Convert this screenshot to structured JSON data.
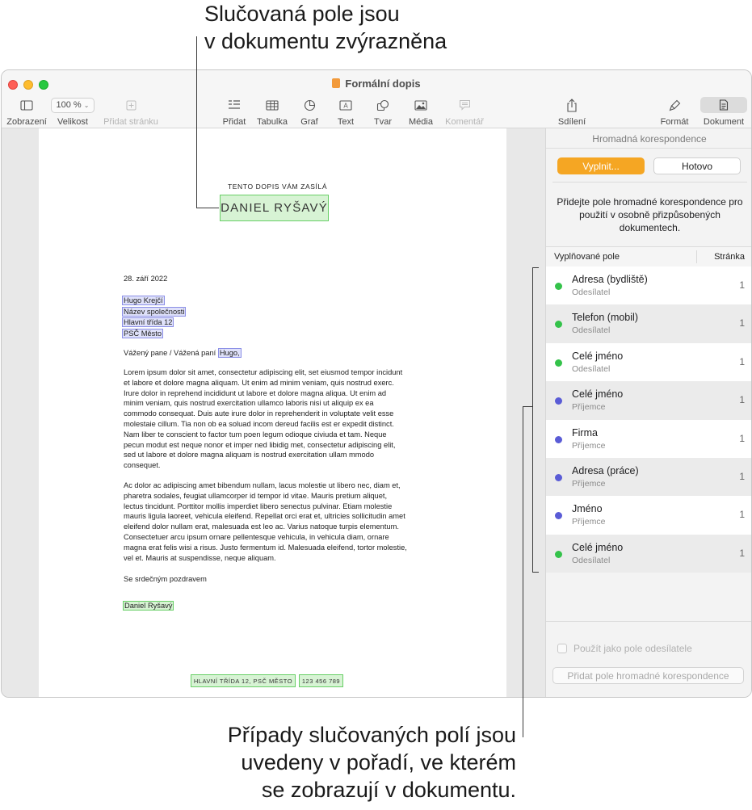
{
  "callouts": {
    "top": [
      "Slučovaná pole jsou",
      "v dokumentu zvýrazněna"
    ],
    "bottom": [
      "Případy slučovaných polí jsou",
      "uvedeny v pořadí, ve kterém",
      "se zobrazují v dokumentu."
    ]
  },
  "window": {
    "title": "Formální dopis"
  },
  "toolbar": {
    "view": "Zobrazení",
    "zoom_value": "100 %",
    "zoom": "Velikost",
    "add_page": "Přidat stránku",
    "insert": "Přidat",
    "table": "Tabulka",
    "chart": "Graf",
    "text": "Text",
    "shape": "Tvar",
    "media": "Média",
    "comment": "Komentář",
    "share": "Sdílení",
    "format": "Formát",
    "document": "Dokument"
  },
  "document": {
    "sender_label": "TENTO DOPIS VÁM ZASÍLÁ",
    "sender_name": "DANIEL RYŠAVÝ",
    "date": "28. září 2022",
    "recipient": [
      "Hugo Krejčí",
      "Název společnosti",
      "Hlavní třída 12",
      "PSČ Město"
    ],
    "greeting_prefix": "Vážený pane / Vážená paní ",
    "greeting_field": "Hugo,",
    "paragraph1": [
      "Lorem ipsum dolor sit amet, consectetur adipiscing elit, set eiusmod tempor incidunt",
      "et labore et dolore magna aliquam. Ut enim ad minim veniam, quis nostrud exerc.",
      "Irure dolor in reprehend incididunt ut labore et dolore magna aliqua. Ut enim ad",
      "minim veniam, quis nostrud exercitation ullamco laboris nisi ut aliquip ex ea",
      "commodo consequat. Duis aute irure dolor in reprehenderit in voluptate velit esse",
      "molestaie cillum. Tia non ob ea soluad incom dereud facilis est er expedit distinct.",
      "Nam liber te conscient to factor tum poen legum odioque civiuda et tam. Neque",
      "pecun modut est neque nonor et imper ned libidig met, consectetur adipiscing elit,",
      "sed ut labore et dolore magna aliquam is nostrud exercitation ullam mmodo",
      "consequet."
    ],
    "paragraph2": [
      "Ac dolor ac adipiscing amet bibendum nullam, lacus molestie ut libero nec, diam et,",
      "pharetra sodales, feugiat ullamcorper id tempor id vitae. Mauris pretium aliquet,",
      "lectus tincidunt. Porttitor mollis imperdiet libero senectus pulvinar. Etiam molestie",
      "mauris ligula laoreet, vehicula eleifend. Repellat orci erat et, ultricies sollicitudin amet",
      "eleifend dolor nullam erat, malesuada est leo ac. Varius natoque turpis elementum.",
      "Consectetuer arcu ipsum ornare pellentesque vehicula, in vehicula diam, ornare",
      "magna erat felis wisi a risus. Justo fermentum id. Malesuada eleifend, tortor molestie,",
      "vel et. Mauris at suspendisse, neque aliquam."
    ],
    "closing": "Se srdečným pozdravem",
    "signature": "Daniel Ryšavý",
    "footer_address": "HLAVNÍ TŘÍDA 12, PSČ MĚSTO",
    "footer_phone": "123 456 789"
  },
  "sidebar": {
    "title": "Hromadná korespondence",
    "fill_button": "Vyplnit...",
    "done_button": "Hotovo",
    "help": "Přidejte pole hromadné korespondence pro použití v osobně přizpůsobených dokumentech.",
    "col_field": "Vyplňované pole",
    "col_page": "Stránka",
    "rows": [
      {
        "name": "Adresa (bydliště)",
        "type": "Odesílatel",
        "page": "1",
        "color": "#34c24a"
      },
      {
        "name": "Telefon (mobil)",
        "type": "Odesílatel",
        "page": "1",
        "color": "#34c24a"
      },
      {
        "name": "Celé jméno",
        "type": "Odesílatel",
        "page": "1",
        "color": "#34c24a"
      },
      {
        "name": "Celé jméno",
        "type": "Příjemce",
        "page": "1",
        "color": "#5a5cd6"
      },
      {
        "name": "Firma",
        "type": "Příjemce",
        "page": "1",
        "color": "#5a5cd6"
      },
      {
        "name": "Adresa (práce)",
        "type": "Příjemce",
        "page": "1",
        "color": "#5a5cd6"
      },
      {
        "name": "Jméno",
        "type": "Příjemce",
        "page": "1",
        "color": "#5a5cd6"
      },
      {
        "name": "Celé jméno",
        "type": "Odesílatel",
        "page": "1",
        "color": "#34c24a"
      }
    ],
    "use_as_sender": "Použít jako pole odesílatele",
    "add_field_button": "Přidat pole hromadné korespondence"
  },
  "colors": {
    "accent": "#f5a623",
    "sender_field": "#34c24a",
    "recipient_field": "#5a5cd6"
  }
}
